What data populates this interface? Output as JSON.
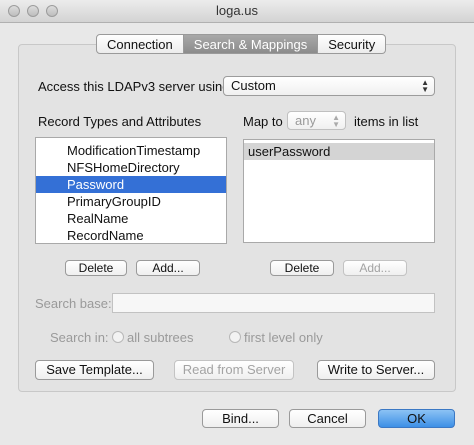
{
  "window": {
    "title": "loga.us"
  },
  "tabs": [
    {
      "label": "Connection",
      "selected": false
    },
    {
      "label": "Search & Mappings",
      "selected": true
    },
    {
      "label": "Security",
      "selected": false
    }
  ],
  "access": {
    "label": "Access this LDAPv3 server using",
    "value": "Custom"
  },
  "records": {
    "header": "Record Types and Attributes",
    "items": [
      {
        "label": "ModificationTimestamp",
        "selected": false
      },
      {
        "label": "NFSHomeDirectory",
        "selected": false
      },
      {
        "label": "Password",
        "selected": true
      },
      {
        "label": "PrimaryGroupID",
        "selected": false
      },
      {
        "label": "RealName",
        "selected": false
      },
      {
        "label": "RecordName",
        "selected": false
      }
    ],
    "delete_label": "Delete",
    "add_label": "Add..."
  },
  "mapping": {
    "map_to_label": "Map to",
    "map_to_value": "any",
    "items_in_list_label": "items in list",
    "items": [
      "userPassword"
    ],
    "delete_label": "Delete",
    "add_label": "Add..."
  },
  "search": {
    "base_label": "Search base:",
    "base_value": "",
    "in_label": "Search in:",
    "option_all": "all subtrees",
    "option_first": "first level only"
  },
  "actions": {
    "save_template": "Save Template...",
    "read_from_server": "Read from Server",
    "write_to_server": "Write to Server..."
  },
  "footer": {
    "bind": "Bind...",
    "cancel": "Cancel",
    "ok": "OK"
  }
}
